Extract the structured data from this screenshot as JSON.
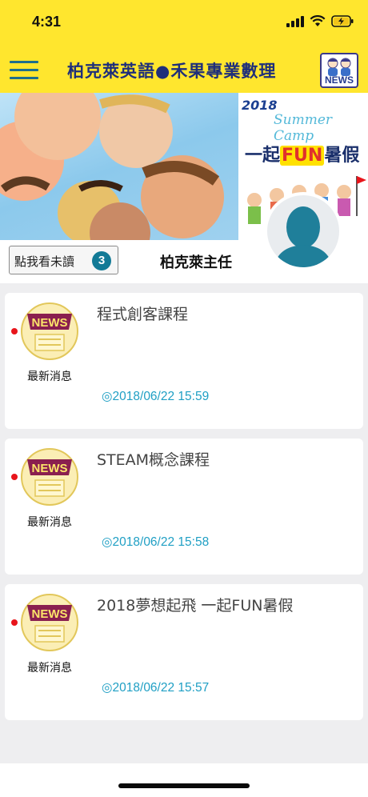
{
  "status_bar": {
    "time": "4:31"
  },
  "header": {
    "title": "柏克萊英語●禾果專業數理",
    "news_button_label": "NEWS"
  },
  "banner": {
    "camp_year": "2018",
    "camp_title": "Summer Camp",
    "camp_slogan_prefix": "一起",
    "camp_slogan_highlight": "FUN",
    "camp_slogan_suffix": "暑假"
  },
  "profile": {
    "unread_button_label": "點我看未讀",
    "unread_count": "3",
    "name": "柏克萊主任"
  },
  "news_items": [
    {
      "title": "程式創客課程",
      "category": "最新消息",
      "icon_label": "NEWS",
      "time": "◎2018/06/22 15:59",
      "unread": true
    },
    {
      "title": "STEAM概念課程",
      "category": "最新消息",
      "icon_label": "NEWS",
      "time": "◎2018/06/22 15:58",
      "unread": true
    },
    {
      "title": "2018夢想起飛 一起FUN暑假",
      "category": "最新消息",
      "icon_label": "NEWS",
      "time": "◎2018/06/22 15:57",
      "unread": true
    }
  ],
  "colors": {
    "header_bg": "#ffe62e",
    "accent": "#127a96",
    "time_text": "#1f9fc4",
    "unread_dot": "#e8151b"
  }
}
